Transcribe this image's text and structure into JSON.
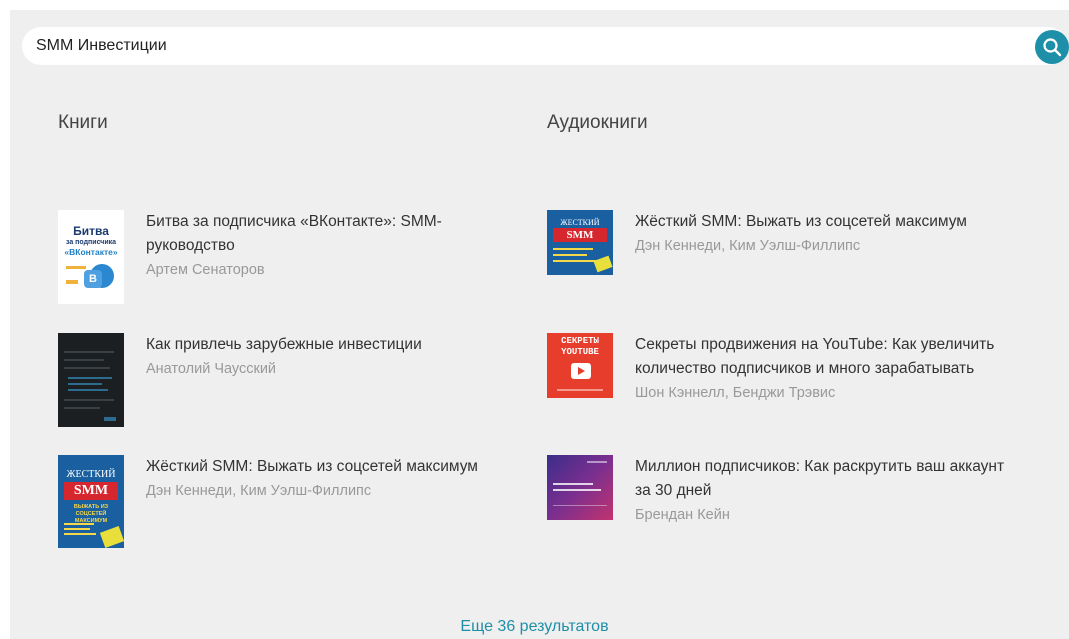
{
  "search": {
    "value": "SMM Инвестиции"
  },
  "books": {
    "heading": "Книги",
    "items": [
      {
        "title": "Битва за подписчика «ВКонтакте»: SMM-руководство",
        "author": "Артем Сенаторов"
      },
      {
        "title": "Как привлечь зарубежные инвестиции",
        "author": "Анатолий Чаусский"
      },
      {
        "title": "Жёсткий SMM: Выжать из соцсетей максимум",
        "author": "Дэн Кеннеди, Ким Уэлш-Филлипс"
      }
    ],
    "cover_texts": {
      "bitva_main": "Битва",
      "bitva_sub": "за подписчика",
      "bitva_vk": "«ВКонтакте»",
      "smm_word": "ЖЕСТКИЙ",
      "smm_big": "SMM",
      "smm_tag": "ВЫЖАТЬ ИЗ СОЦСЕТЕЙ МАКСИМУМ"
    }
  },
  "audiobooks": {
    "heading": "Аудиокниги",
    "items": [
      {
        "title": "Жёсткий SMM: Выжать из соцсетей максимум",
        "author": "Дэн Кеннеди, Ким Уэлш-Филлипс"
      },
      {
        "title": "Секреты продвижения на YouTube: Как увеличить количество подписчиков и много зарабатывать",
        "author": "Шон Кэннелл, Бенджи Трэвис"
      },
      {
        "title": "Миллион подписчиков: Как раскрутить ваш аккаунт за 30 дней",
        "author": "Брендан Кейн"
      }
    ],
    "cover_texts": {
      "yt_line1": "СЕКРЕТЫ",
      "yt_line2": "YOUTUBE"
    }
  },
  "more_results": "Еще 36 результатов",
  "colors": {
    "accent": "#1e8fa8",
    "background": "#efefef",
    "author": "#999999",
    "title": "#333333"
  },
  "icons": {
    "search": "search-icon"
  }
}
